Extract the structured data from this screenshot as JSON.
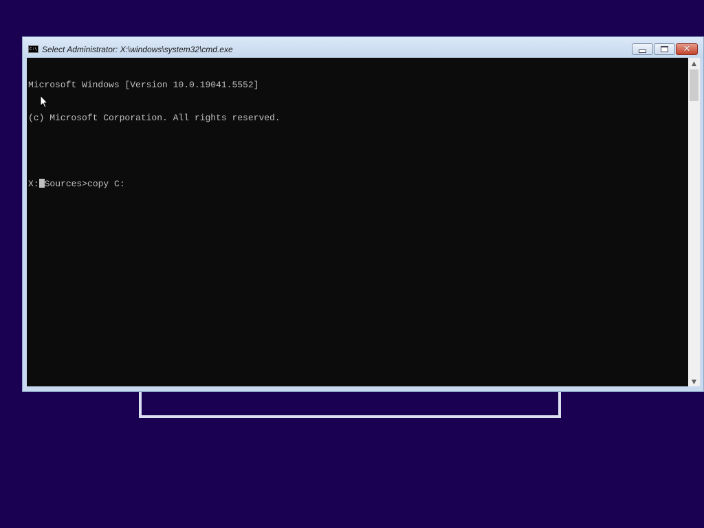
{
  "window": {
    "title": "Select Administrator: X:\\windows\\system32\\cmd.exe",
    "icon": "cmd-icon",
    "icon_text": "C:\\",
    "buttons": {
      "minimize": "minimize-icon",
      "maximize": "maximize-icon",
      "close": "close-icon",
      "close_glyph": "✕"
    }
  },
  "console": {
    "lines": [
      "Microsoft Windows [Version 10.0.19041.5552]",
      "(c) Microsoft Corporation. All rights reserved.",
      ""
    ],
    "prompt_prefix": "X:",
    "prompt_rest": "Sources>copy C:"
  },
  "scrollbar": {
    "up_glyph": "▲",
    "down_glyph": "▼"
  },
  "colors": {
    "desktop": "#1b0152",
    "console_bg": "#0c0c0c",
    "console_fg": "#c0c0c0",
    "close_button": "#c3432c"
  }
}
